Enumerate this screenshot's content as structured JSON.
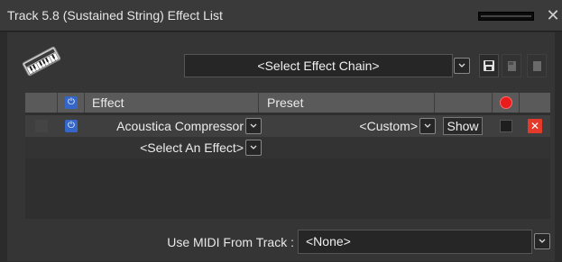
{
  "window": {
    "title": "Track 5.8 (Sustained String) Effect List",
    "close_glyph": "✕"
  },
  "toolbar": {
    "effect_chain_value": "<Select Effect Chain>",
    "save_icon": "save-icon",
    "open_icon": "open-chain-icon",
    "new_icon": "new-chain-icon"
  },
  "table": {
    "headers": {
      "effect": "Effect",
      "preset": "Preset"
    },
    "rows": [
      {
        "effect": "Acoustica Compressor",
        "preset": "<Custom>",
        "show_label": "Show",
        "enabled": true
      },
      {
        "effect": "<Select An Effect>"
      }
    ]
  },
  "midi": {
    "label": "Use MIDI From Track :",
    "value": "<None>"
  },
  "colors": {
    "power_blue": "#3467c9",
    "record_red": "#e81c1c",
    "remove_red": "#e33a2b"
  }
}
